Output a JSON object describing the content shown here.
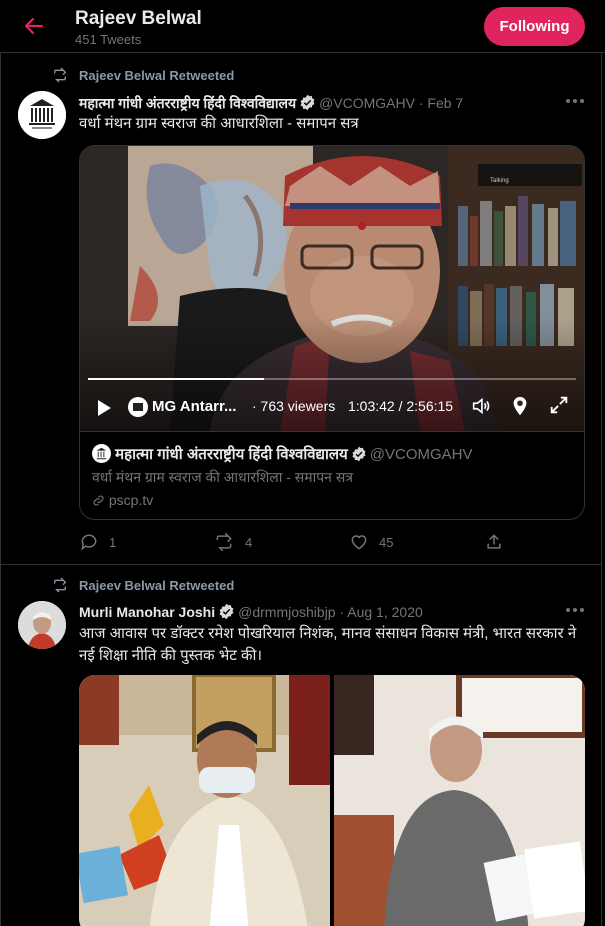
{
  "header": {
    "title": "Rajeev Belwal",
    "tweet_count": "451 Tweets",
    "follow_button": "Following"
  },
  "tweets": [
    {
      "retweet_label": "Rajeev Belwal Retweeted",
      "author": "महात्मा गांधी अंतरराष्ट्रीय हिंदी विश्वविद्यालय",
      "handle_date": "@VCOMGAHV · Feb 7",
      "text": "वर्धा मंथन ग्राम स्वराज की आधारशिला - समापन  सत्र",
      "card": {
        "channel": "MG Antarr...",
        "viewers": "· 763 viewers",
        "time": "1:03:42 / 2:56:15",
        "progress": 0.36,
        "title": "महात्मा गांधी अंतरराष्ट्रीय हिंदी विश्वविद्यालय",
        "handle": "@VCOMGAHV",
        "subtitle": "वर्धा मंथन ग्राम स्वराज की आधारशिला - समापन  सत्र",
        "link": "pscp.tv",
        "overlay_label": "Talking"
      },
      "actions": {
        "replies": "1",
        "retweets": "4",
        "likes": "45"
      }
    },
    {
      "retweet_label": "Rajeev Belwal Retweeted",
      "author": "Murli Manohar Joshi",
      "handle_date": "@drmmjoshibjp · Aug 1, 2020",
      "text": "आज आवास पर डॉक्टर रमेश पोखरियाल निशंक, मानव संसाधन विकास मंत्री, भारत सरकार ने नई शिक्षा नीति की पुस्तक भेट की।"
    }
  ],
  "colors": {
    "accent": "#e0245e",
    "verified": "#d9d9d9",
    "muted": "#71767b"
  },
  "icons": [
    "back-arrow-icon",
    "retweet-icon",
    "verified-icon",
    "more-icon",
    "play-icon",
    "volume-icon",
    "location-icon",
    "fullscreen-icon",
    "link-icon",
    "reply-icon",
    "like-icon",
    "share-icon"
  ]
}
